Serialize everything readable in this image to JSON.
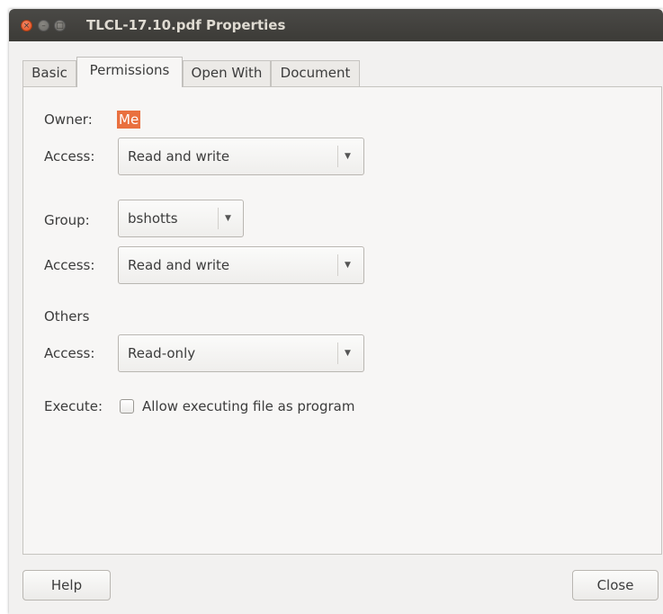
{
  "window": {
    "title": "TLCL-17.10.pdf Properties",
    "close_glyph": "×",
    "minimize_glyph": "–",
    "maximize_glyph": "□"
  },
  "tabs": [
    {
      "label": "Basic",
      "active": false
    },
    {
      "label": "Permissions",
      "active": true
    },
    {
      "label": "Open With",
      "active": false
    },
    {
      "label": "Document",
      "active": false
    }
  ],
  "permissions": {
    "owner_label": "Owner:",
    "owner_value": "Me",
    "owner_access_label": "Access:",
    "owner_access_value": "Read and write",
    "group_label": "Group:",
    "group_value": "bshotts",
    "group_access_label": "Access:",
    "group_access_value": "Read and write",
    "others_label": "Others",
    "others_access_label": "Access:",
    "others_access_value": "Read-only",
    "execute_label": "Execute:",
    "execute_checkbox_label": "Allow executing file as program",
    "execute_checked": false
  },
  "buttons": {
    "help": "Help",
    "close": "Close"
  },
  "colors": {
    "titlebar": "#3c3b37",
    "selection_accent": "#e9703f",
    "close_button": "#df4a16"
  }
}
